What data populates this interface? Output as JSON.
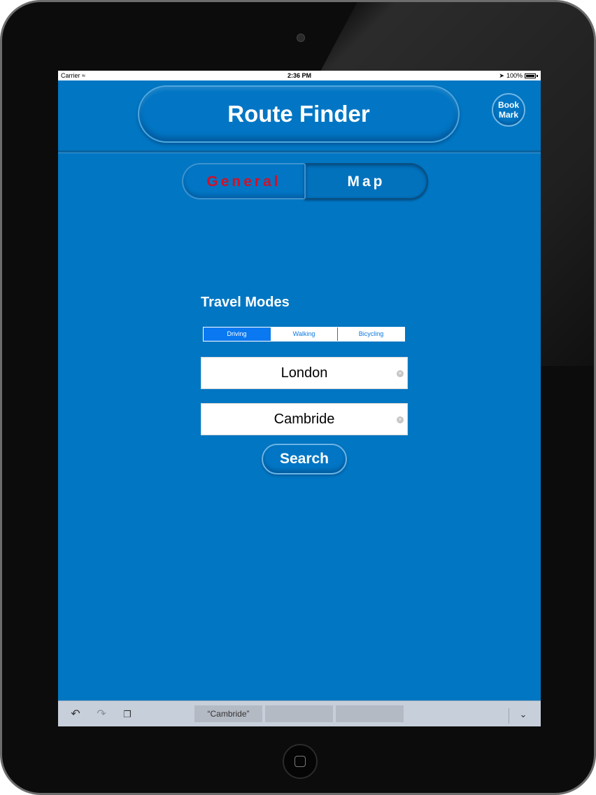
{
  "status_bar": {
    "carrier": "Carrier",
    "time": "2:36 PM",
    "battery": "100%"
  },
  "header": {
    "title": "Route Finder",
    "bookmark_line1": "Book",
    "bookmark_line2": "Mark"
  },
  "tabs": [
    {
      "label": "General",
      "color": "#d0102a"
    },
    {
      "label": "Map",
      "color": "#ffffff"
    }
  ],
  "travel": {
    "title": "Travel Modes",
    "modes": [
      "Driving",
      "Walking",
      "Bicycling"
    ],
    "selected_mode": "Driving"
  },
  "origin_field": {
    "value": "London"
  },
  "destination_field": {
    "value": "Cambride"
  },
  "search_button": {
    "label": "Search"
  },
  "keyboard_bar": {
    "suggestions": [
      "“Cambride”",
      "",
      ""
    ],
    "icons": [
      "undo-icon",
      "redo-icon",
      "paste-icon",
      "chevron-down-icon"
    ]
  },
  "colors": {
    "screen_background": "#0176c2",
    "accent": "#0a78f0",
    "general_tab_text": "#d0102a"
  }
}
